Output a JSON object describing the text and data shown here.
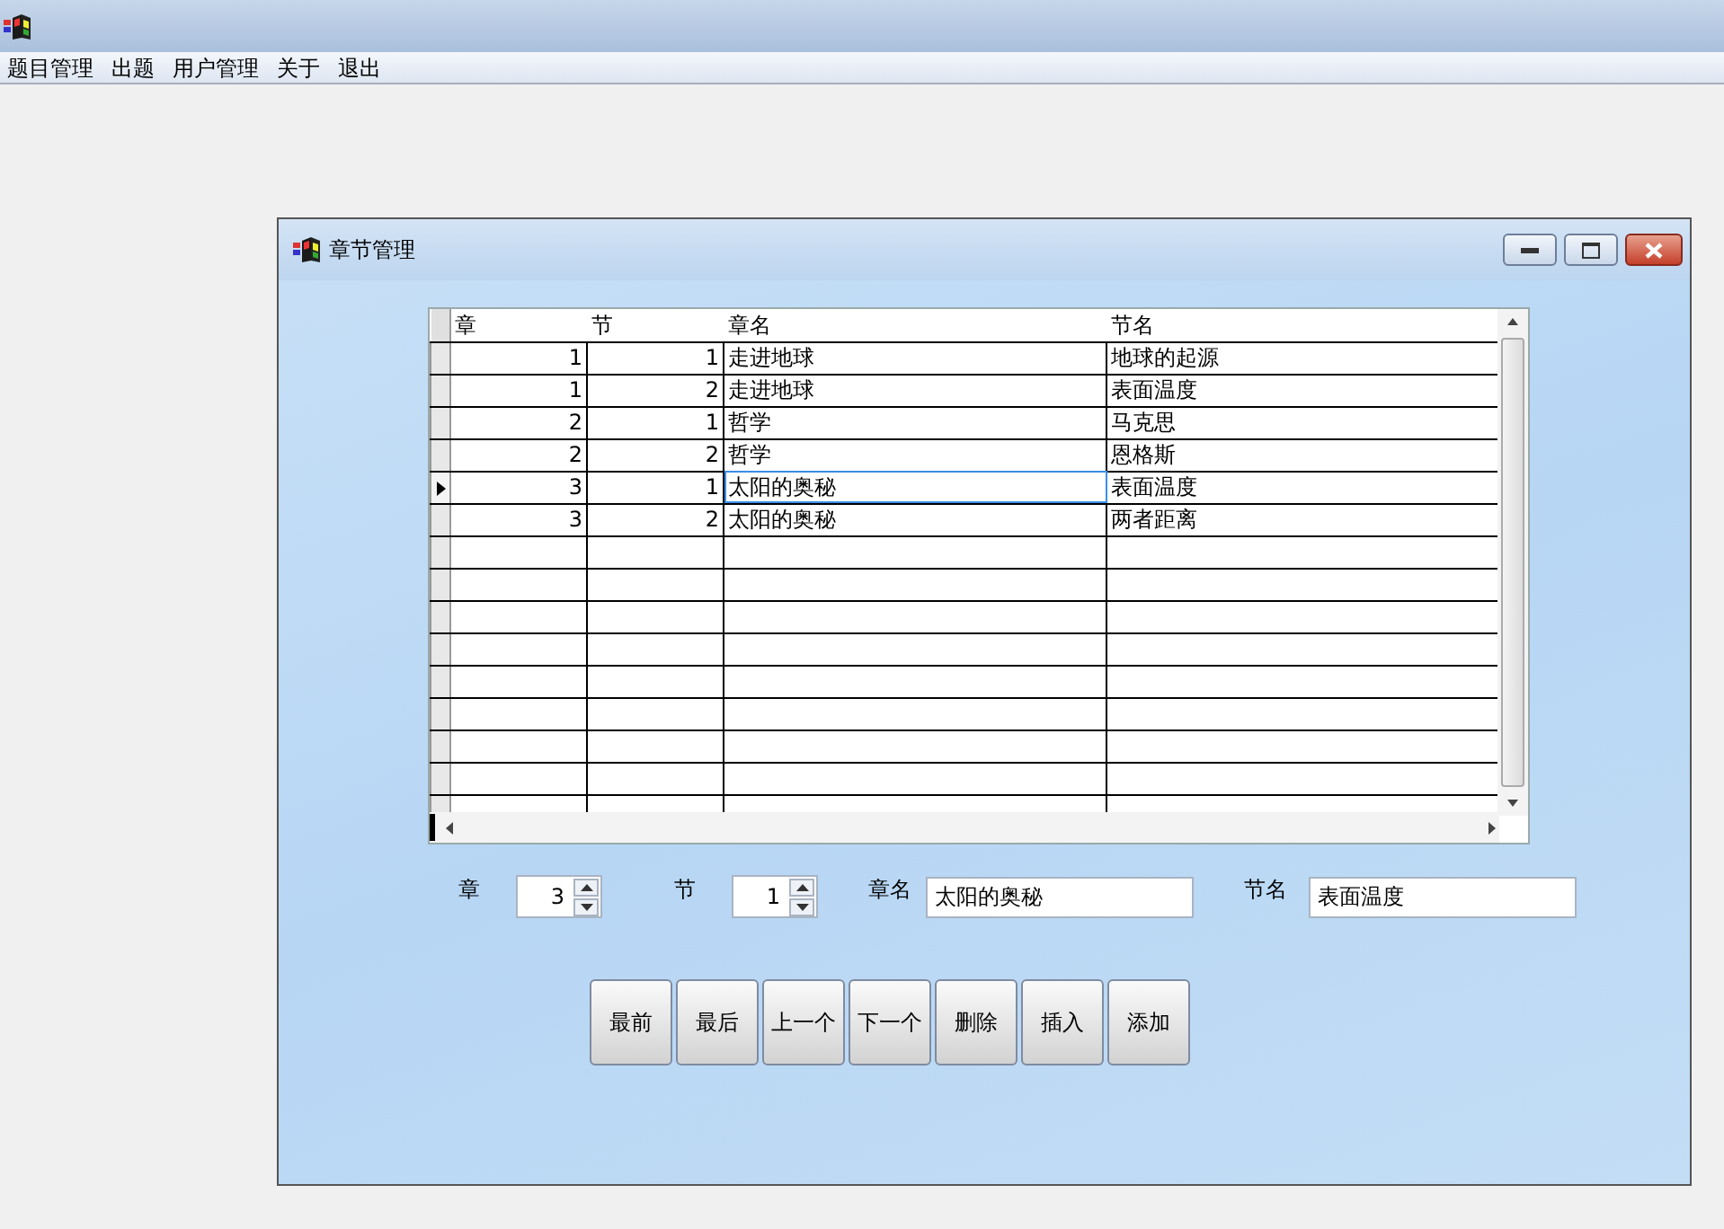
{
  "menu": [
    {
      "label": "题目管理"
    },
    {
      "label": "出题"
    },
    {
      "label": "用户管理"
    },
    {
      "label": "关于"
    },
    {
      "label": "退出"
    }
  ],
  "dialog": {
    "title": "章节管理",
    "table": {
      "columns": [
        "章",
        "节",
        "章名",
        "节名"
      ],
      "rows": [
        {
          "cells": [
            "1",
            "1",
            "走进地球",
            "地球的起源"
          ],
          "selected": false
        },
        {
          "cells": [
            "1",
            "2",
            "走进地球",
            "表面温度"
          ],
          "selected": false
        },
        {
          "cells": [
            "2",
            "1",
            "哲学",
            "马克思"
          ],
          "selected": false
        },
        {
          "cells": [
            "2",
            "2",
            "哲学",
            "恩格斯"
          ],
          "selected": false
        },
        {
          "cells": [
            "3",
            "1",
            "太阳的奥秘",
            "表面温度"
          ],
          "selected": true
        },
        {
          "cells": [
            "3",
            "2",
            "太阳的奥秘",
            "两者距离"
          ],
          "selected": false
        }
      ]
    },
    "fields": [
      {
        "label": "章",
        "value": "3",
        "kind": "spinner"
      },
      {
        "label": "节",
        "value": "1",
        "kind": "spinner"
      },
      {
        "label": "章名",
        "value": "太阳的奥秘",
        "kind": "text"
      },
      {
        "label": "节名",
        "value": "表面温度",
        "kind": "text"
      }
    ],
    "buttons": [
      "最前",
      "最后",
      "上一个",
      "下一个",
      "删除",
      "插入",
      "添加"
    ]
  }
}
